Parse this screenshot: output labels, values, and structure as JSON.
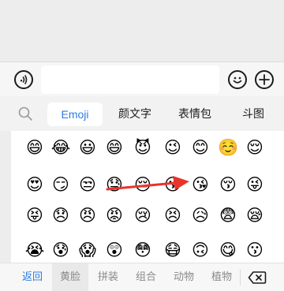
{
  "input_bar": {
    "voice_icon": "voice-icon",
    "text_value": "",
    "emoji_icon": "smiley-icon",
    "plus_icon": "plus-icon"
  },
  "tabs": {
    "search_icon": "search-icon",
    "items": [
      "Emoji",
      "颜文字",
      "表情包",
      "斗图"
    ],
    "active": "Emoji"
  },
  "emoji_grid": {
    "rows": [
      [
        "😄",
        "😂",
        "😃",
        "😄",
        "😈",
        "😉",
        "😊",
        "☺️",
        "😌"
      ],
      [
        "😍",
        "😏",
        "😒",
        "😓",
        "😔",
        "😘",
        "😘",
        "😚",
        "😜"
      ],
      [
        "😝",
        "😞",
        "😠",
        "😡",
        "😢",
        "😣",
        "😥",
        "😨",
        "😪"
      ],
      [
        "😭",
        "😰",
        "😱",
        "😲",
        "😳",
        "😷",
        "🙃",
        "😋",
        "😗"
      ]
    ]
  },
  "annotation": {
    "arrow_color": "#e8342b",
    "target": "😘"
  },
  "bottom_bar": {
    "back_label": "返回",
    "categories": [
      "黄脸",
      "拼装",
      "组合",
      "动物",
      "植物"
    ],
    "active": "黄脸",
    "backspace_icon": "backspace-icon"
  },
  "colors": {
    "accent": "#2a7be8",
    "tab_bg": "#f2f2f2",
    "grid_bg": "#ffffff"
  }
}
